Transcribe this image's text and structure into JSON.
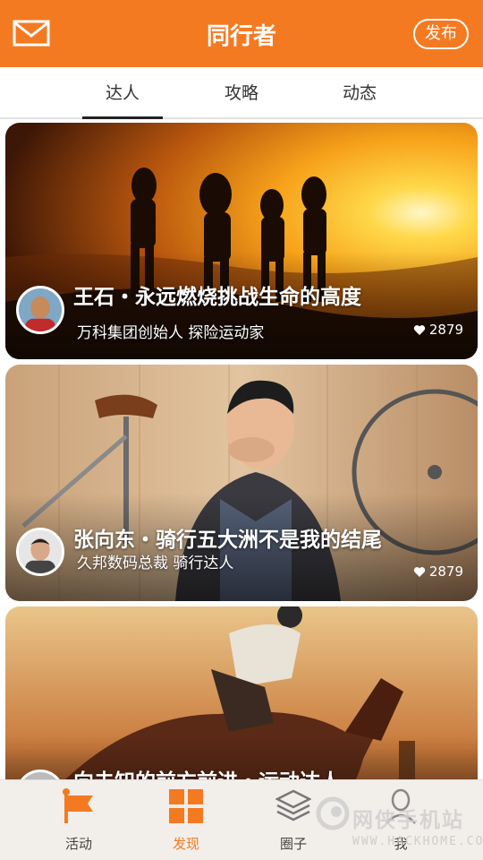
{
  "header": {
    "title": "同行者",
    "publish_label": "发布",
    "mail_icon": "mail-icon",
    "background": "#f47a22"
  },
  "tabs": [
    {
      "label": "达人",
      "active": true
    },
    {
      "label": "攻略",
      "active": false
    },
    {
      "label": "动态",
      "active": false
    }
  ],
  "cards": [
    {
      "title": "王石・永远燃烧挑战生命的高度",
      "subtitle": "万科集团创始人  探险运动家",
      "likes": "2879"
    },
    {
      "title": "张向东・骑行五大洲不是我的结尾",
      "subtitle": "久邦数码总裁  骑行达人",
      "likes": "2879"
    },
    {
      "title": "向未知的前方前进・运动达人",
      "subtitle": "",
      "likes": ""
    }
  ],
  "bottom_nav": [
    {
      "label": "活动",
      "icon": "flag-icon",
      "active": false
    },
    {
      "label": "发现",
      "icon": "grid-icon",
      "active": true
    },
    {
      "label": "圈子",
      "icon": "layers-icon",
      "active": false
    },
    {
      "label": "我",
      "icon": "person-icon",
      "active": false
    }
  ],
  "watermark": {
    "text": "网侠手机站",
    "url": "WWW.HACKHOME.COM"
  },
  "colors": {
    "accent": "#f47a22",
    "tab_bar_bg": "#f2eeea"
  }
}
